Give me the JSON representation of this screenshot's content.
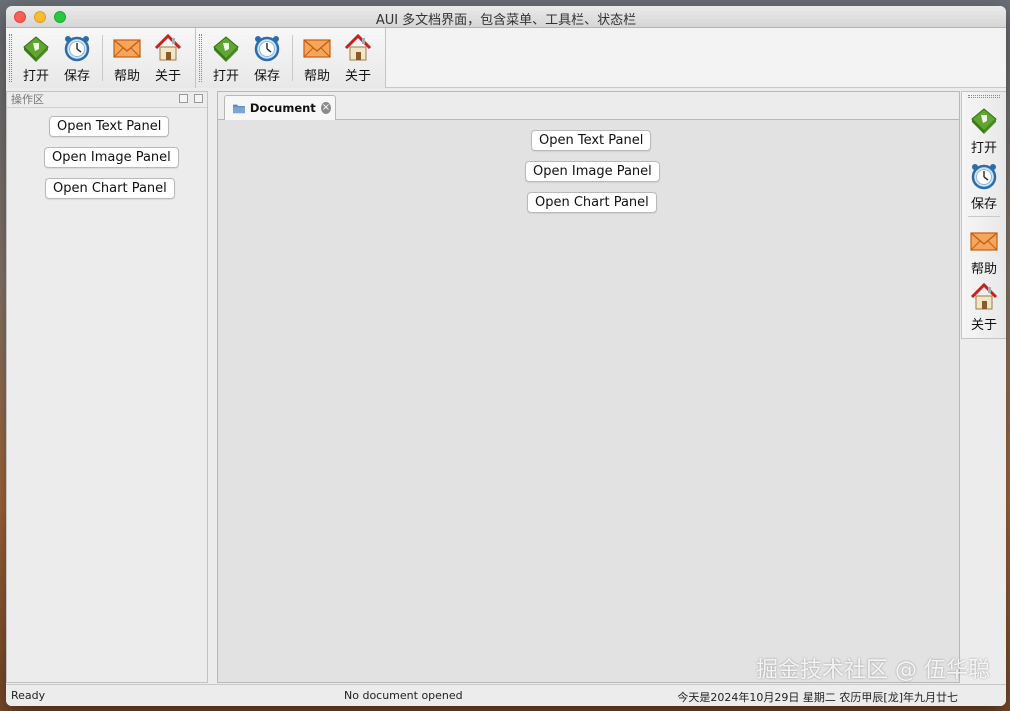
{
  "window": {
    "title": "AUI 多文档界面，包含菜单、工具栏、状态栏"
  },
  "toolbar": {
    "open_label": "打开",
    "save_label": "保存",
    "help_label": "帮助",
    "about_label": "关于"
  },
  "dock": {
    "title": "操作区",
    "buttons": [
      "Open Text Panel",
      "Open Image Panel",
      "Open Chart Panel"
    ]
  },
  "document": {
    "tab_label": "Document",
    "buttons": [
      "Open Text Panel",
      "Open Image Panel",
      "Open Chart Panel"
    ]
  },
  "statusbar": {
    "left": "Ready",
    "middle": "No document opened",
    "right": "今天是2024年10月29日 星期二 农历甲辰[龙]年九月廿七"
  },
  "watermark": "掘金技术社区 @ 伍华聪",
  "icons": {
    "open": "open-book-icon",
    "save": "alarm-clock-icon",
    "help": "envelope-icon",
    "about": "home-icon"
  }
}
